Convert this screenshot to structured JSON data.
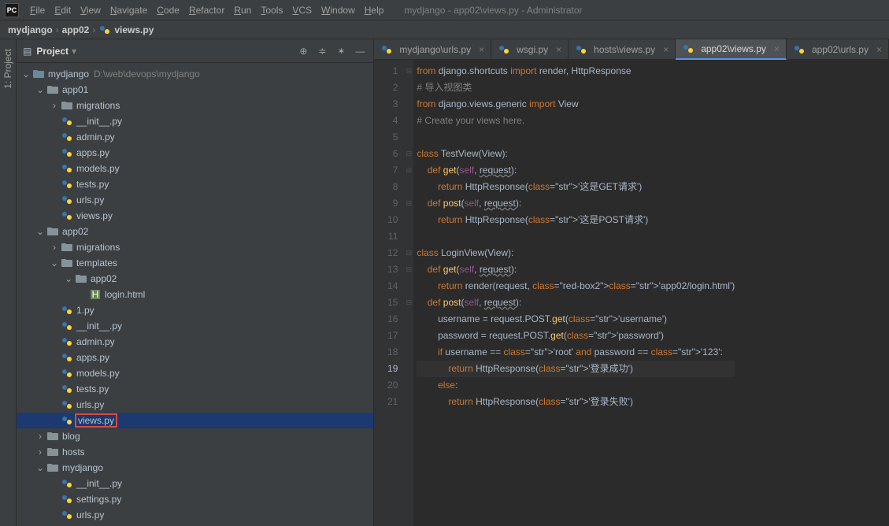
{
  "window_title": "mydjango - app02\\views.py - Administrator",
  "menu": [
    "File",
    "Edit",
    "View",
    "Navigate",
    "Code",
    "Refactor",
    "Run",
    "Tools",
    "VCS",
    "Window",
    "Help"
  ],
  "breadcrumb": {
    "root": "mydjango",
    "mid": "app02",
    "file": "views.py"
  },
  "sidebar": {
    "project_label": "1: Project"
  },
  "project": {
    "title": "Project",
    "root": {
      "name": "mydjango",
      "path": "D:\\web\\devops\\mydjango"
    },
    "tree": [
      {
        "d": 1,
        "a": "v",
        "t": "proj",
        "l": "mydjango",
        "extra": "D:\\web\\devops\\mydjango"
      },
      {
        "d": 2,
        "a": "v",
        "t": "dir",
        "l": "app01"
      },
      {
        "d": 3,
        "a": ">",
        "t": "dir",
        "l": "migrations"
      },
      {
        "d": 3,
        "a": "",
        "t": "py",
        "l": "__init__.py"
      },
      {
        "d": 3,
        "a": "",
        "t": "py",
        "l": "admin.py"
      },
      {
        "d": 3,
        "a": "",
        "t": "py",
        "l": "apps.py"
      },
      {
        "d": 3,
        "a": "",
        "t": "py",
        "l": "models.py"
      },
      {
        "d": 3,
        "a": "",
        "t": "py",
        "l": "tests.py"
      },
      {
        "d": 3,
        "a": "",
        "t": "py",
        "l": "urls.py"
      },
      {
        "d": 3,
        "a": "",
        "t": "py",
        "l": "views.py"
      },
      {
        "d": 2,
        "a": "v",
        "t": "dir",
        "l": "app02"
      },
      {
        "d": 3,
        "a": ">",
        "t": "dir",
        "l": "migrations"
      },
      {
        "d": 3,
        "a": "v",
        "t": "dir",
        "l": "templates"
      },
      {
        "d": 4,
        "a": "v",
        "t": "dir",
        "l": "app02"
      },
      {
        "d": 5,
        "a": "",
        "t": "html",
        "l": "login.html"
      },
      {
        "d": 3,
        "a": "",
        "t": "py",
        "l": "1.py"
      },
      {
        "d": 3,
        "a": "",
        "t": "py",
        "l": "__init__.py"
      },
      {
        "d": 3,
        "a": "",
        "t": "py",
        "l": "admin.py"
      },
      {
        "d": 3,
        "a": "",
        "t": "py",
        "l": "apps.py"
      },
      {
        "d": 3,
        "a": "",
        "t": "py",
        "l": "models.py"
      },
      {
        "d": 3,
        "a": "",
        "t": "py",
        "l": "tests.py"
      },
      {
        "d": 3,
        "a": "",
        "t": "py",
        "l": "urls.py"
      },
      {
        "d": 3,
        "a": "",
        "t": "py",
        "l": "views.py",
        "selected": true,
        "boxed": true
      },
      {
        "d": 2,
        "a": ">",
        "t": "dir",
        "l": "blog"
      },
      {
        "d": 2,
        "a": ">",
        "t": "dir",
        "l": "hosts"
      },
      {
        "d": 2,
        "a": "v",
        "t": "dir",
        "l": "mydjango"
      },
      {
        "d": 3,
        "a": "",
        "t": "py",
        "l": "__init__.py"
      },
      {
        "d": 3,
        "a": "",
        "t": "py",
        "l": "settings.py"
      },
      {
        "d": 3,
        "a": "",
        "t": "py",
        "l": "urls.py"
      }
    ]
  },
  "tabs": [
    {
      "l": "mydjango\\urls.py"
    },
    {
      "l": "wsgi.py"
    },
    {
      "l": "hosts\\views.py"
    },
    {
      "l": "app02\\views.py",
      "active": true
    },
    {
      "l": "app02\\urls.py"
    }
  ],
  "code": {
    "lines": 21,
    "highlight_line": 19,
    "text": [
      "from django.shortcuts import render, HttpResponse",
      "# 导入视图类",
      "from django.views.generic import View",
      "# Create your views here.",
      "",
      "class TestView(View):",
      "    def get(self, request):",
      "        return HttpResponse('这是GET请求')",
      "    def post(self, request):",
      "        return HttpResponse('这是POST请求')",
      "",
      "class LoginView(View):",
      "    def get(self, request):",
      "        return render(request, 'app02/login.html')",
      "    def post(self, request):",
      "        username = request.POST.get('username')",
      "        password = request.POST.get('password')",
      "        if username == 'root' and password == '123':",
      "            return HttpResponse('登录成功')",
      "        else:",
      "            return HttpResponse('登录失败')"
    ],
    "boxed_string": "'app02/login.html'"
  }
}
